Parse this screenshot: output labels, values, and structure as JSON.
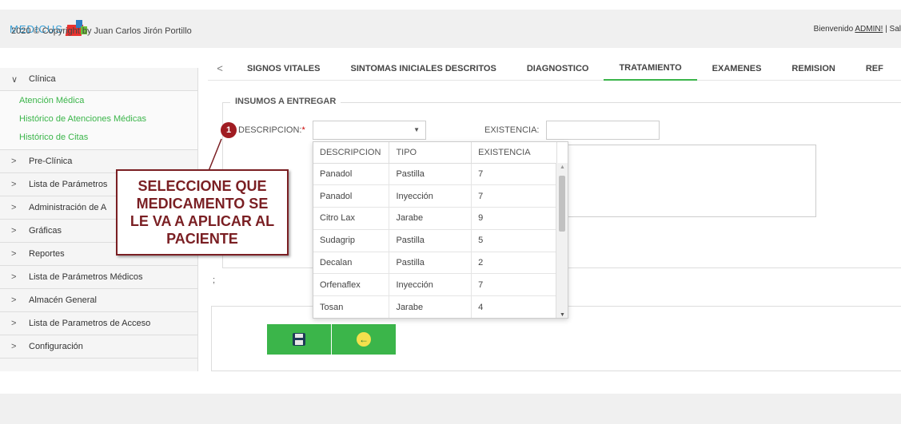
{
  "header": {
    "logo_text": "MEDICUS",
    "welcome_prefix": "Bienvenido ",
    "welcome_user": "ADMIN!",
    "welcome_suffix": " | Sal"
  },
  "sidebar": {
    "sections": [
      {
        "label": "Clínica",
        "expanded": true
      },
      {
        "label": "Pre-Clínica"
      },
      {
        "label": "Lista de Parámetros"
      },
      {
        "label": "Administración de A"
      },
      {
        "label": "Gráficas"
      },
      {
        "label": "Reportes"
      },
      {
        "label": "Lista de Parámetros Médicos"
      },
      {
        "label": "Almacén General"
      },
      {
        "label": "Lista de Parametros de Acceso"
      },
      {
        "label": "Configuración"
      }
    ],
    "clinica_items": [
      "Atención Médica",
      "Histórico de Atenciones Médicas",
      "Histórico de Citas"
    ]
  },
  "tabs": {
    "items": [
      "SIGNOS VITALES",
      "SINTOMAS INICIALES DESCRITOS",
      "DIAGNOSTICO",
      "TRATAMIENTO",
      "EXAMENES",
      "REMISION",
      "REF"
    ],
    "active": "TRATAMIENTO"
  },
  "form": {
    "legend": "INSUMOS A ENTREGAR",
    "badge": "1",
    "descripcion_label": "DESCRIPCION:",
    "required_mark": "*",
    "existencia_label": "EXISTENCIA:",
    "semicolon": ";"
  },
  "dropdown": {
    "headers": [
      "DESCRIPCION",
      "TIPO",
      "EXISTENCIA"
    ],
    "rows": [
      [
        "Panadol",
        "Pastilla",
        "7"
      ],
      [
        "Panadol",
        "Inyección",
        "7"
      ],
      [
        "Citro Lax",
        "Jarabe",
        "9"
      ],
      [
        "Sudagrip",
        "Pastilla",
        "5"
      ],
      [
        "Decalan",
        "Pastilla",
        "2"
      ],
      [
        "Orfenaflex",
        "Inyección",
        "7"
      ],
      [
        "Tosan",
        "Jarabe",
        "4"
      ]
    ]
  },
  "callout": {
    "line1": "SELECCIONE QUE",
    "line2": "MEDICAMENTO SE",
    "line3": "LE VA A APLICAR AL",
    "line4": "PACIENTE"
  },
  "footer": {
    "text": "2020 © Copyright by Juan Carlos Jirón Portillo"
  },
  "colors": {
    "accent_green": "#3bb54a",
    "callout_red": "#7a1f23",
    "badge_red": "#a01c22"
  }
}
